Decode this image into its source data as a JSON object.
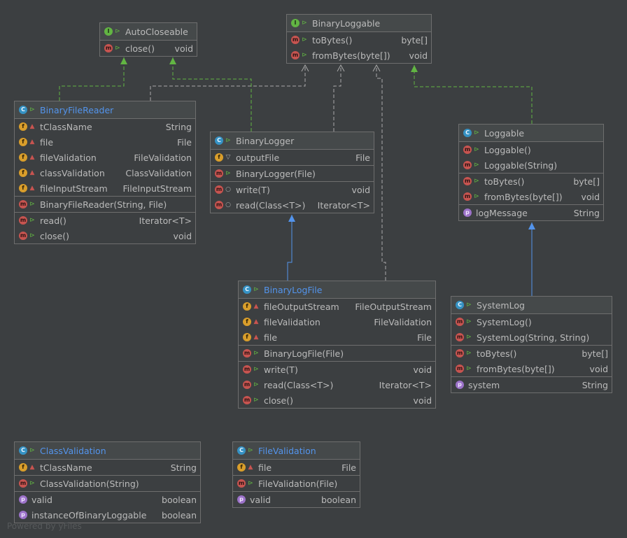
{
  "colors": {
    "background": "#3c3f41",
    "border": "#6e6e6e",
    "extends_edge": "#5394ec",
    "implements_edge": "#62b543",
    "usage_edge": "#aaaaaa"
  },
  "nodes": {
    "auto_closeable": {
      "title": "AutoCloseable",
      "kind": "interface",
      "sections": [
        [
          {
            "badge": "m",
            "vis": "public",
            "name": "close()",
            "type": "void"
          }
        ]
      ]
    },
    "binary_loggable": {
      "title": "BinaryLoggable",
      "kind": "interface",
      "sections": [
        [
          {
            "badge": "m",
            "vis": "public",
            "name": "toBytes()",
            "type": "byte[]"
          },
          {
            "badge": "m",
            "vis": "public",
            "name": "fromBytes(byte[])",
            "type": "void"
          }
        ]
      ]
    },
    "binary_file_reader": {
      "title": "BinaryFileReader",
      "kind": "class",
      "highlight": true,
      "sections": [
        [
          {
            "badge": "f",
            "vis": "private",
            "name": "tClassName",
            "type": "String"
          },
          {
            "badge": "f",
            "vis": "private",
            "name": "file",
            "type": "File"
          },
          {
            "badge": "f",
            "vis": "private",
            "name": "fileValidation",
            "type": "FileValidation"
          },
          {
            "badge": "f",
            "vis": "private",
            "name": "classValidation",
            "type": "ClassValidation"
          },
          {
            "badge": "f",
            "vis": "private",
            "name": "fileInputStream",
            "type": "FileInputStream"
          }
        ],
        [
          {
            "badge": "m",
            "vis": "public",
            "name": "BinaryFileReader(String, File)",
            "type": ""
          }
        ],
        [
          {
            "badge": "m",
            "vis": "public",
            "name": "read()",
            "type": "Iterator<T>"
          },
          {
            "badge": "m",
            "vis": "public",
            "name": "close()",
            "type": "void"
          }
        ]
      ]
    },
    "binary_logger": {
      "title": "BinaryLogger",
      "kind": "abstract",
      "sections": [
        [
          {
            "badge": "f",
            "vis": "protected",
            "name": "outputFile",
            "type": "File"
          }
        ],
        [
          {
            "badge": "m",
            "vis": "public",
            "name": "BinaryLogger(File)",
            "type": ""
          }
        ],
        [
          {
            "badge": "m",
            "vis": "package",
            "name": "write(T)",
            "type": "void"
          },
          {
            "badge": "m",
            "vis": "package",
            "name": "read(Class<T>)",
            "type": "Iterator<T>"
          }
        ]
      ]
    },
    "loggable": {
      "title": "Loggable",
      "kind": "class",
      "sections": [
        [
          {
            "badge": "m",
            "vis": "public",
            "name": "Loggable()",
            "type": ""
          },
          {
            "badge": "m",
            "vis": "public",
            "name": "Loggable(String)",
            "type": ""
          }
        ],
        [
          {
            "badge": "m",
            "vis": "public",
            "name": "toBytes()",
            "type": "byte[]"
          },
          {
            "badge": "m",
            "vis": "public",
            "name": "fromBytes(byte[])",
            "type": "void"
          }
        ],
        [
          {
            "badge": "p",
            "vis": "",
            "name": "logMessage",
            "type": "String"
          }
        ]
      ]
    },
    "binary_log_file": {
      "title": "BinaryLogFile",
      "kind": "class",
      "highlight": true,
      "sections": [
        [
          {
            "badge": "f",
            "vis": "private",
            "name": "fileOutputStream",
            "type": "FileOutputStream"
          },
          {
            "badge": "f",
            "vis": "private",
            "name": "fileValidation",
            "type": "FileValidation"
          },
          {
            "badge": "f",
            "vis": "private",
            "name": "file",
            "type": "File"
          }
        ],
        [
          {
            "badge": "m",
            "vis": "public",
            "name": "BinaryLogFile(File)",
            "type": ""
          }
        ],
        [
          {
            "badge": "m",
            "vis": "public",
            "name": "write(T)",
            "type": "void"
          },
          {
            "badge": "m",
            "vis": "public",
            "name": "read(Class<T>)",
            "type": "Iterator<T>"
          },
          {
            "badge": "m",
            "vis": "public",
            "name": "close()",
            "type": "void"
          }
        ]
      ]
    },
    "system_log": {
      "title": "SystemLog",
      "kind": "class",
      "sections": [
        [
          {
            "badge": "m",
            "vis": "public",
            "name": "SystemLog()",
            "type": ""
          },
          {
            "badge": "m",
            "vis": "public",
            "name": "SystemLog(String, String)",
            "type": ""
          }
        ],
        [
          {
            "badge": "m",
            "vis": "public",
            "name": "toBytes()",
            "type": "byte[]"
          },
          {
            "badge": "m",
            "vis": "public",
            "name": "fromBytes(byte[])",
            "type": "void"
          }
        ],
        [
          {
            "badge": "p",
            "vis": "",
            "name": "system",
            "type": "String"
          }
        ]
      ]
    },
    "class_validation": {
      "title": "ClassValidation",
      "kind": "class",
      "highlight": true,
      "sections": [
        [
          {
            "badge": "f",
            "vis": "private",
            "name": "tClassName",
            "type": "String"
          }
        ],
        [
          {
            "badge": "m",
            "vis": "public",
            "name": "ClassValidation(String)",
            "type": ""
          }
        ],
        [
          {
            "badge": "p",
            "vis": "",
            "name": "valid",
            "type": "boolean"
          },
          {
            "badge": "p",
            "vis": "",
            "name": "instanceOfBinaryLoggable",
            "type": "boolean"
          }
        ]
      ]
    },
    "file_validation": {
      "title": "FileValidation",
      "kind": "class",
      "highlight": true,
      "sections": [
        [
          {
            "badge": "f",
            "vis": "private",
            "name": "file",
            "type": "File"
          }
        ],
        [
          {
            "badge": "m",
            "vis": "public",
            "name": "FileValidation(File)",
            "type": ""
          }
        ],
        [
          {
            "badge": "p",
            "vis": "",
            "name": "valid",
            "type": "boolean"
          }
        ]
      ]
    }
  },
  "edges": [
    {
      "from": "binary_file_reader",
      "to": "auto_closeable",
      "kind": "implements"
    },
    {
      "from": "binary_file_reader",
      "to": "binary_loggable",
      "kind": "usage"
    },
    {
      "from": "binary_logger",
      "to": "auto_closeable",
      "kind": "implements"
    },
    {
      "from": "binary_logger",
      "to": "binary_loggable",
      "kind": "usage"
    },
    {
      "from": "binary_log_file",
      "to": "binary_loggable",
      "kind": "usage"
    },
    {
      "from": "loggable",
      "to": "binary_loggable",
      "kind": "implements"
    },
    {
      "from": "binary_log_file",
      "to": "binary_logger",
      "kind": "extends"
    },
    {
      "from": "system_log",
      "to": "loggable",
      "kind": "extends"
    }
  ],
  "footer": "Powered by yFiles"
}
